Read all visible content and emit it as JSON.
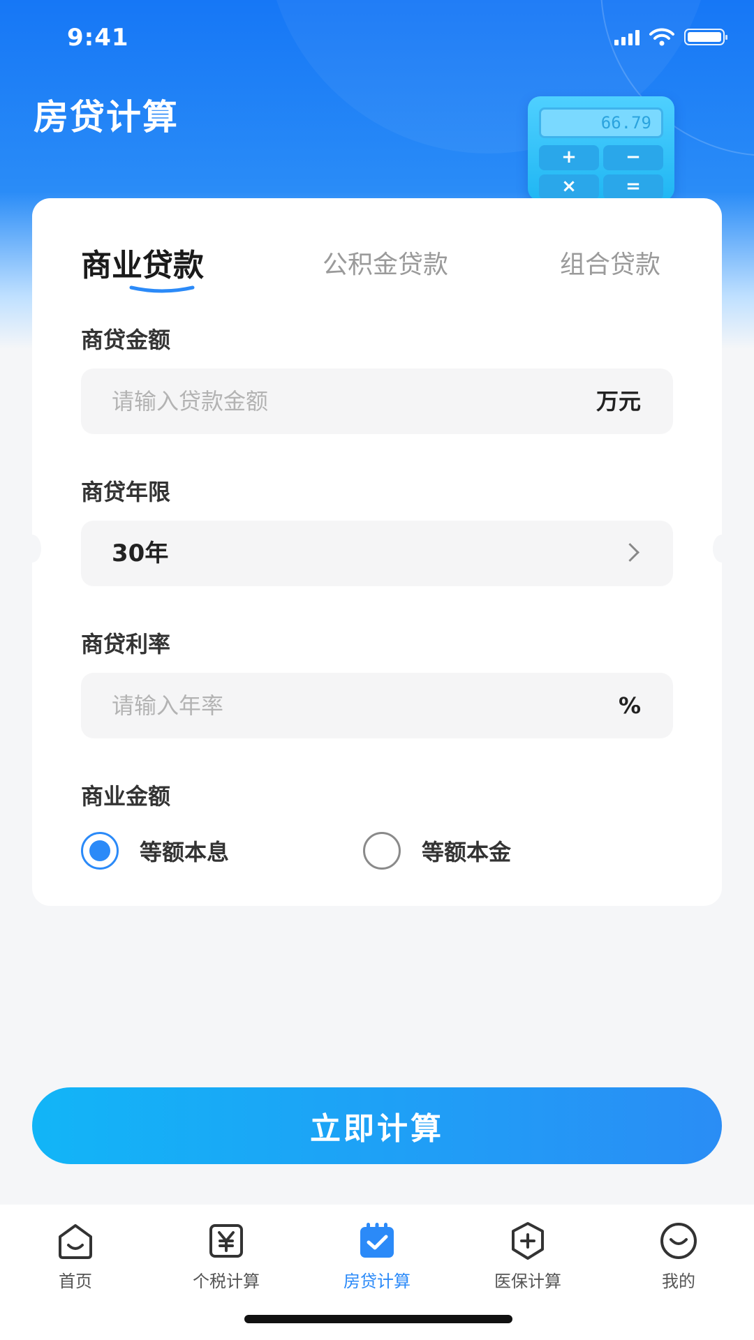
{
  "status_bar": {
    "time": "9:41"
  },
  "header": {
    "title": "房贷计算",
    "calculator_display": "66.79",
    "calculator_keys": [
      "+",
      "−",
      "×",
      "="
    ]
  },
  "tabs": [
    {
      "label": "商业贷款",
      "active": true
    },
    {
      "label": "公积金贷款",
      "active": false
    },
    {
      "label": "组合贷款",
      "active": false
    }
  ],
  "form": {
    "amount": {
      "label": "商贷金额",
      "placeholder": "请输入贷款金额",
      "unit": "万元",
      "value": ""
    },
    "term": {
      "label": "商贷年限",
      "value": "30年"
    },
    "rate": {
      "label": "商贷利率",
      "placeholder": "请输入年率",
      "unit": "%",
      "value": ""
    },
    "method": {
      "label": "商业金额",
      "options": [
        {
          "label": "等额本息",
          "checked": true
        },
        {
          "label": "等额本金",
          "checked": false
        }
      ]
    }
  },
  "submit_label": "立即计算",
  "tabbar": {
    "items": [
      {
        "label": "首页",
        "icon": "home-icon",
        "active": false
      },
      {
        "label": "个税计算",
        "icon": "yen-icon",
        "active": false
      },
      {
        "label": "房贷计算",
        "icon": "calendar-check-icon",
        "active": true
      },
      {
        "label": "医保计算",
        "icon": "medical-shield-icon",
        "active": false
      },
      {
        "label": "我的",
        "icon": "smile-icon",
        "active": false
      }
    ]
  },
  "colors": {
    "primary": "#2b8af8",
    "header_blue": "#1677f6",
    "button_start": "#12b5f7",
    "button_end": "#2a8df5",
    "page_bg": "#f5f6f8"
  }
}
